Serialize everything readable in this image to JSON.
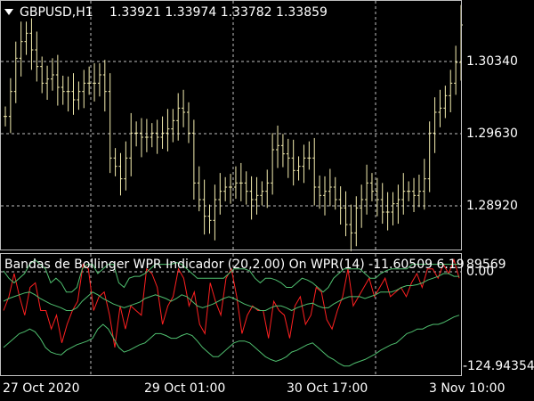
{
  "colors": {
    "background": "#000000",
    "grid": "#bfbfbf",
    "price_bars": "#f5eeb0",
    "wpr_line": "#ff2020",
    "band_line": "#4fbf6f",
    "text": "#ffffff"
  },
  "main_chart": {
    "header_symbol": "GBPUSD,H1",
    "header_ohlc": "1.33921 1.33974 1.33782 1.33859",
    "dropdown_icon": "triangle-down-icon",
    "price_labels": [
      "1.30340",
      "1.29630",
      "1.28920"
    ]
  },
  "indicator": {
    "header": "Bandas de Bollinger WPR Indicador (20,2.00) On WPR(14) -11.60509 6.19",
    "top_value": "89569",
    "zero_label": "0.00",
    "bottom_label": "-124.94354"
  },
  "time_axis": {
    "labels": [
      "27 Oct 2020",
      "29 Oct 01:00",
      "30 Oct 17:00",
      "3 Nov 10:00"
    ]
  },
  "chart_data": [
    {
      "type": "line",
      "series": [
        {
          "name": "GBPUSD,H1",
          "values": [
            1.301,
            1.304,
            1.308,
            1.31,
            1.311,
            1.309,
            1.307,
            1.305,
            1.3055,
            1.306,
            1.3045,
            1.304,
            1.304,
            1.303,
            1.304,
            1.305,
            1.305,
            1.305,
            1.306,
            1.304,
            1.296,
            1.295,
            1.2935,
            1.296,
            1.299,
            1.299,
            1.2985,
            1.2985,
            1.299,
            1.2985,
            1.299,
            1.2995,
            1.3005,
            1.302,
            1.3015,
            1.299,
            1.293,
            1.291,
            1.289,
            1.2885,
            1.291,
            1.292,
            1.2925,
            1.2925,
            1.293,
            1.293,
            1.292,
            1.291,
            1.2915,
            1.292,
            1.293,
            1.297,
            1.2975,
            1.2965,
            1.296,
            1.2945,
            1.295,
            1.296,
            1.296,
            1.2925,
            1.2915,
            1.292,
            1.2925,
            1.291,
            1.29,
            1.288,
            1.287,
            1.29,
            1.291,
            1.293,
            1.292,
            1.291,
            1.2895,
            1.2895,
            1.2905,
            1.291,
            1.292,
            1.292,
            1.2915,
            1.292,
            1.2935,
            1.299,
            1.3015,
            1.302,
            1.3035,
            1.305,
            1.3075,
            1.312
          ]
        }
      ]
    },
    {
      "type": "line",
      "ylim": [
        -124.94354,
        6.1989569
      ],
      "series": [
        {
          "name": "WPR",
          "values": [
            -55,
            -40,
            -15,
            -40,
            -60,
            -30,
            -25,
            -55,
            -55,
            -75,
            -60,
            -90,
            -70,
            -55,
            -45,
            -5,
            -10,
            -55,
            -40,
            -35,
            -60,
            -95,
            -50,
            -75,
            -50,
            -55,
            -60,
            -10,
            -15,
            -30,
            -70,
            -50,
            -40,
            -10,
            -20,
            -50,
            -35,
            -70,
            -80,
            -25,
            -45,
            -60,
            -20,
            -10,
            -40,
            -80,
            -60,
            -50,
            -55,
            -55,
            -85,
            -45,
            -55,
            -60,
            -85,
            -50,
            -40,
            -70,
            -60,
            -30,
            -35,
            -65,
            -75,
            -55,
            -40,
            -10,
            -50,
            -40,
            -30,
            -20,
            -40,
            -30,
            -20,
            -40,
            -35,
            -30,
            -40,
            -25,
            -15,
            -30,
            -10,
            -10,
            -20,
            -5,
            -15,
            0,
            -20
          ]
        },
        {
          "name": "upper",
          "values": [
            -12,
            -20,
            -25,
            -20,
            -15,
            -5,
            0,
            -5,
            -10,
            -25,
            -20,
            -25,
            -35,
            -35,
            -30,
            -10,
            -5,
            -5,
            -15,
            -10,
            -5,
            -5,
            -25,
            -30,
            -20,
            -18,
            -18,
            -15,
            -10,
            -5,
            -5,
            -5,
            -5,
            -3,
            -5,
            -10,
            -15,
            -20,
            -20,
            -20,
            -20,
            -20,
            -20,
            -15,
            -10,
            -10,
            -10,
            -12,
            -20,
            -25,
            -20,
            -20,
            -22,
            -25,
            -30,
            -30,
            -25,
            -20,
            -22,
            -25,
            -30,
            -35,
            -30,
            -20,
            -15,
            -10,
            -10,
            -10,
            -10,
            -15,
            -20,
            -20,
            -15,
            -12,
            -10,
            -10,
            -10,
            -10,
            -5,
            -5,
            -5,
            -5,
            -5,
            -5,
            -5,
            -5,
            -5,
            -5
          ]
        },
        {
          "name": "middle",
          "values": [
            -45,
            -42,
            -40,
            -38,
            -36,
            -35,
            -38,
            -42,
            -45,
            -48,
            -50,
            -52,
            -55,
            -55,
            -52,
            -45,
            -40,
            -35,
            -38,
            -42,
            -45,
            -48,
            -50,
            -52,
            -50,
            -48,
            -46,
            -42,
            -40,
            -38,
            -40,
            -42,
            -45,
            -42,
            -38,
            -40,
            -45,
            -50,
            -52,
            -50,
            -48,
            -45,
            -42,
            -40,
            -42,
            -45,
            -48,
            -50,
            -52,
            -55,
            -55,
            -52,
            -50,
            -50,
            -52,
            -55,
            -52,
            -50,
            -48,
            -47,
            -50,
            -52,
            -52,
            -48,
            -45,
            -42,
            -40,
            -40,
            -40,
            -42,
            -40,
            -38,
            -35,
            -35,
            -35,
            -33,
            -30,
            -28,
            -28,
            -27,
            -25,
            -22,
            -20,
            -18,
            -15,
            -15,
            -18,
            -18
          ]
        },
        {
          "name": "lower",
          "values": [
            -95,
            -90,
            -85,
            -80,
            -78,
            -75,
            -78,
            -85,
            -95,
            -100,
            -102,
            -103,
            -98,
            -95,
            -92,
            -90,
            -88,
            -85,
            -75,
            -70,
            -75,
            -85,
            -95,
            -100,
            -98,
            -95,
            -92,
            -90,
            -85,
            -80,
            -80,
            -82,
            -85,
            -85,
            -82,
            -80,
            -82,
            -88,
            -95,
            -100,
            -105,
            -105,
            -100,
            -95,
            -90,
            -88,
            -88,
            -90,
            -95,
            -100,
            -105,
            -108,
            -110,
            -108,
            -105,
            -100,
            -98,
            -95,
            -92,
            -90,
            -95,
            -100,
            -105,
            -108,
            -112,
            -115,
            -115,
            -112,
            -110,
            -108,
            -105,
            -102,
            -98,
            -95,
            -92,
            -90,
            -85,
            -80,
            -78,
            -75,
            -75,
            -72,
            -70,
            -70,
            -68,
            -65,
            -62,
            -60
          ]
        }
      ]
    }
  ]
}
